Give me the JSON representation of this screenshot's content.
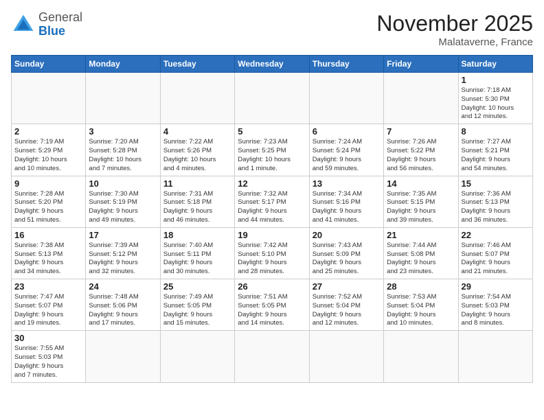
{
  "header": {
    "logo_general": "General",
    "logo_blue": "Blue",
    "month_title": "November 2025",
    "subtitle": "Malataverne, France"
  },
  "weekdays": [
    "Sunday",
    "Monday",
    "Tuesday",
    "Wednesday",
    "Thursday",
    "Friday",
    "Saturday"
  ],
  "weeks": [
    [
      {
        "day": "",
        "info": ""
      },
      {
        "day": "",
        "info": ""
      },
      {
        "day": "",
        "info": ""
      },
      {
        "day": "",
        "info": ""
      },
      {
        "day": "",
        "info": ""
      },
      {
        "day": "",
        "info": ""
      },
      {
        "day": "1",
        "info": "Sunrise: 7:18 AM\nSunset: 5:30 PM\nDaylight: 10 hours\nand 12 minutes."
      }
    ],
    [
      {
        "day": "2",
        "info": "Sunrise: 7:19 AM\nSunset: 5:29 PM\nDaylight: 10 hours\nand 10 minutes."
      },
      {
        "day": "3",
        "info": "Sunrise: 7:20 AM\nSunset: 5:28 PM\nDaylight: 10 hours\nand 7 minutes."
      },
      {
        "day": "4",
        "info": "Sunrise: 7:22 AM\nSunset: 5:26 PM\nDaylight: 10 hours\nand 4 minutes."
      },
      {
        "day": "5",
        "info": "Sunrise: 7:23 AM\nSunset: 5:25 PM\nDaylight: 10 hours\nand 1 minute."
      },
      {
        "day": "6",
        "info": "Sunrise: 7:24 AM\nSunset: 5:24 PM\nDaylight: 9 hours\nand 59 minutes."
      },
      {
        "day": "7",
        "info": "Sunrise: 7:26 AM\nSunset: 5:22 PM\nDaylight: 9 hours\nand 56 minutes."
      },
      {
        "day": "8",
        "info": "Sunrise: 7:27 AM\nSunset: 5:21 PM\nDaylight: 9 hours\nand 54 minutes."
      }
    ],
    [
      {
        "day": "9",
        "info": "Sunrise: 7:28 AM\nSunset: 5:20 PM\nDaylight: 9 hours\nand 51 minutes."
      },
      {
        "day": "10",
        "info": "Sunrise: 7:30 AM\nSunset: 5:19 PM\nDaylight: 9 hours\nand 49 minutes."
      },
      {
        "day": "11",
        "info": "Sunrise: 7:31 AM\nSunset: 5:18 PM\nDaylight: 9 hours\nand 46 minutes."
      },
      {
        "day": "12",
        "info": "Sunrise: 7:32 AM\nSunset: 5:17 PM\nDaylight: 9 hours\nand 44 minutes."
      },
      {
        "day": "13",
        "info": "Sunrise: 7:34 AM\nSunset: 5:16 PM\nDaylight: 9 hours\nand 41 minutes."
      },
      {
        "day": "14",
        "info": "Sunrise: 7:35 AM\nSunset: 5:15 PM\nDaylight: 9 hours\nand 39 minutes."
      },
      {
        "day": "15",
        "info": "Sunrise: 7:36 AM\nSunset: 5:13 PM\nDaylight: 9 hours\nand 36 minutes."
      }
    ],
    [
      {
        "day": "16",
        "info": "Sunrise: 7:38 AM\nSunset: 5:13 PM\nDaylight: 9 hours\nand 34 minutes."
      },
      {
        "day": "17",
        "info": "Sunrise: 7:39 AM\nSunset: 5:12 PM\nDaylight: 9 hours\nand 32 minutes."
      },
      {
        "day": "18",
        "info": "Sunrise: 7:40 AM\nSunset: 5:11 PM\nDaylight: 9 hours\nand 30 minutes."
      },
      {
        "day": "19",
        "info": "Sunrise: 7:42 AM\nSunset: 5:10 PM\nDaylight: 9 hours\nand 28 minutes."
      },
      {
        "day": "20",
        "info": "Sunrise: 7:43 AM\nSunset: 5:09 PM\nDaylight: 9 hours\nand 25 minutes."
      },
      {
        "day": "21",
        "info": "Sunrise: 7:44 AM\nSunset: 5:08 PM\nDaylight: 9 hours\nand 23 minutes."
      },
      {
        "day": "22",
        "info": "Sunrise: 7:46 AM\nSunset: 5:07 PM\nDaylight: 9 hours\nand 21 minutes."
      }
    ],
    [
      {
        "day": "23",
        "info": "Sunrise: 7:47 AM\nSunset: 5:07 PM\nDaylight: 9 hours\nand 19 minutes."
      },
      {
        "day": "24",
        "info": "Sunrise: 7:48 AM\nSunset: 5:06 PM\nDaylight: 9 hours\nand 17 minutes."
      },
      {
        "day": "25",
        "info": "Sunrise: 7:49 AM\nSunset: 5:05 PM\nDaylight: 9 hours\nand 15 minutes."
      },
      {
        "day": "26",
        "info": "Sunrise: 7:51 AM\nSunset: 5:05 PM\nDaylight: 9 hours\nand 14 minutes."
      },
      {
        "day": "27",
        "info": "Sunrise: 7:52 AM\nSunset: 5:04 PM\nDaylight: 9 hours\nand 12 minutes."
      },
      {
        "day": "28",
        "info": "Sunrise: 7:53 AM\nSunset: 5:04 PM\nDaylight: 9 hours\nand 10 minutes."
      },
      {
        "day": "29",
        "info": "Sunrise: 7:54 AM\nSunset: 5:03 PM\nDaylight: 9 hours\nand 8 minutes."
      }
    ],
    [
      {
        "day": "30",
        "info": "Sunrise: 7:55 AM\nSunset: 5:03 PM\nDaylight: 9 hours\nand 7 minutes."
      },
      {
        "day": "",
        "info": ""
      },
      {
        "day": "",
        "info": ""
      },
      {
        "day": "",
        "info": ""
      },
      {
        "day": "",
        "info": ""
      },
      {
        "day": "",
        "info": ""
      },
      {
        "day": "",
        "info": ""
      }
    ]
  ]
}
